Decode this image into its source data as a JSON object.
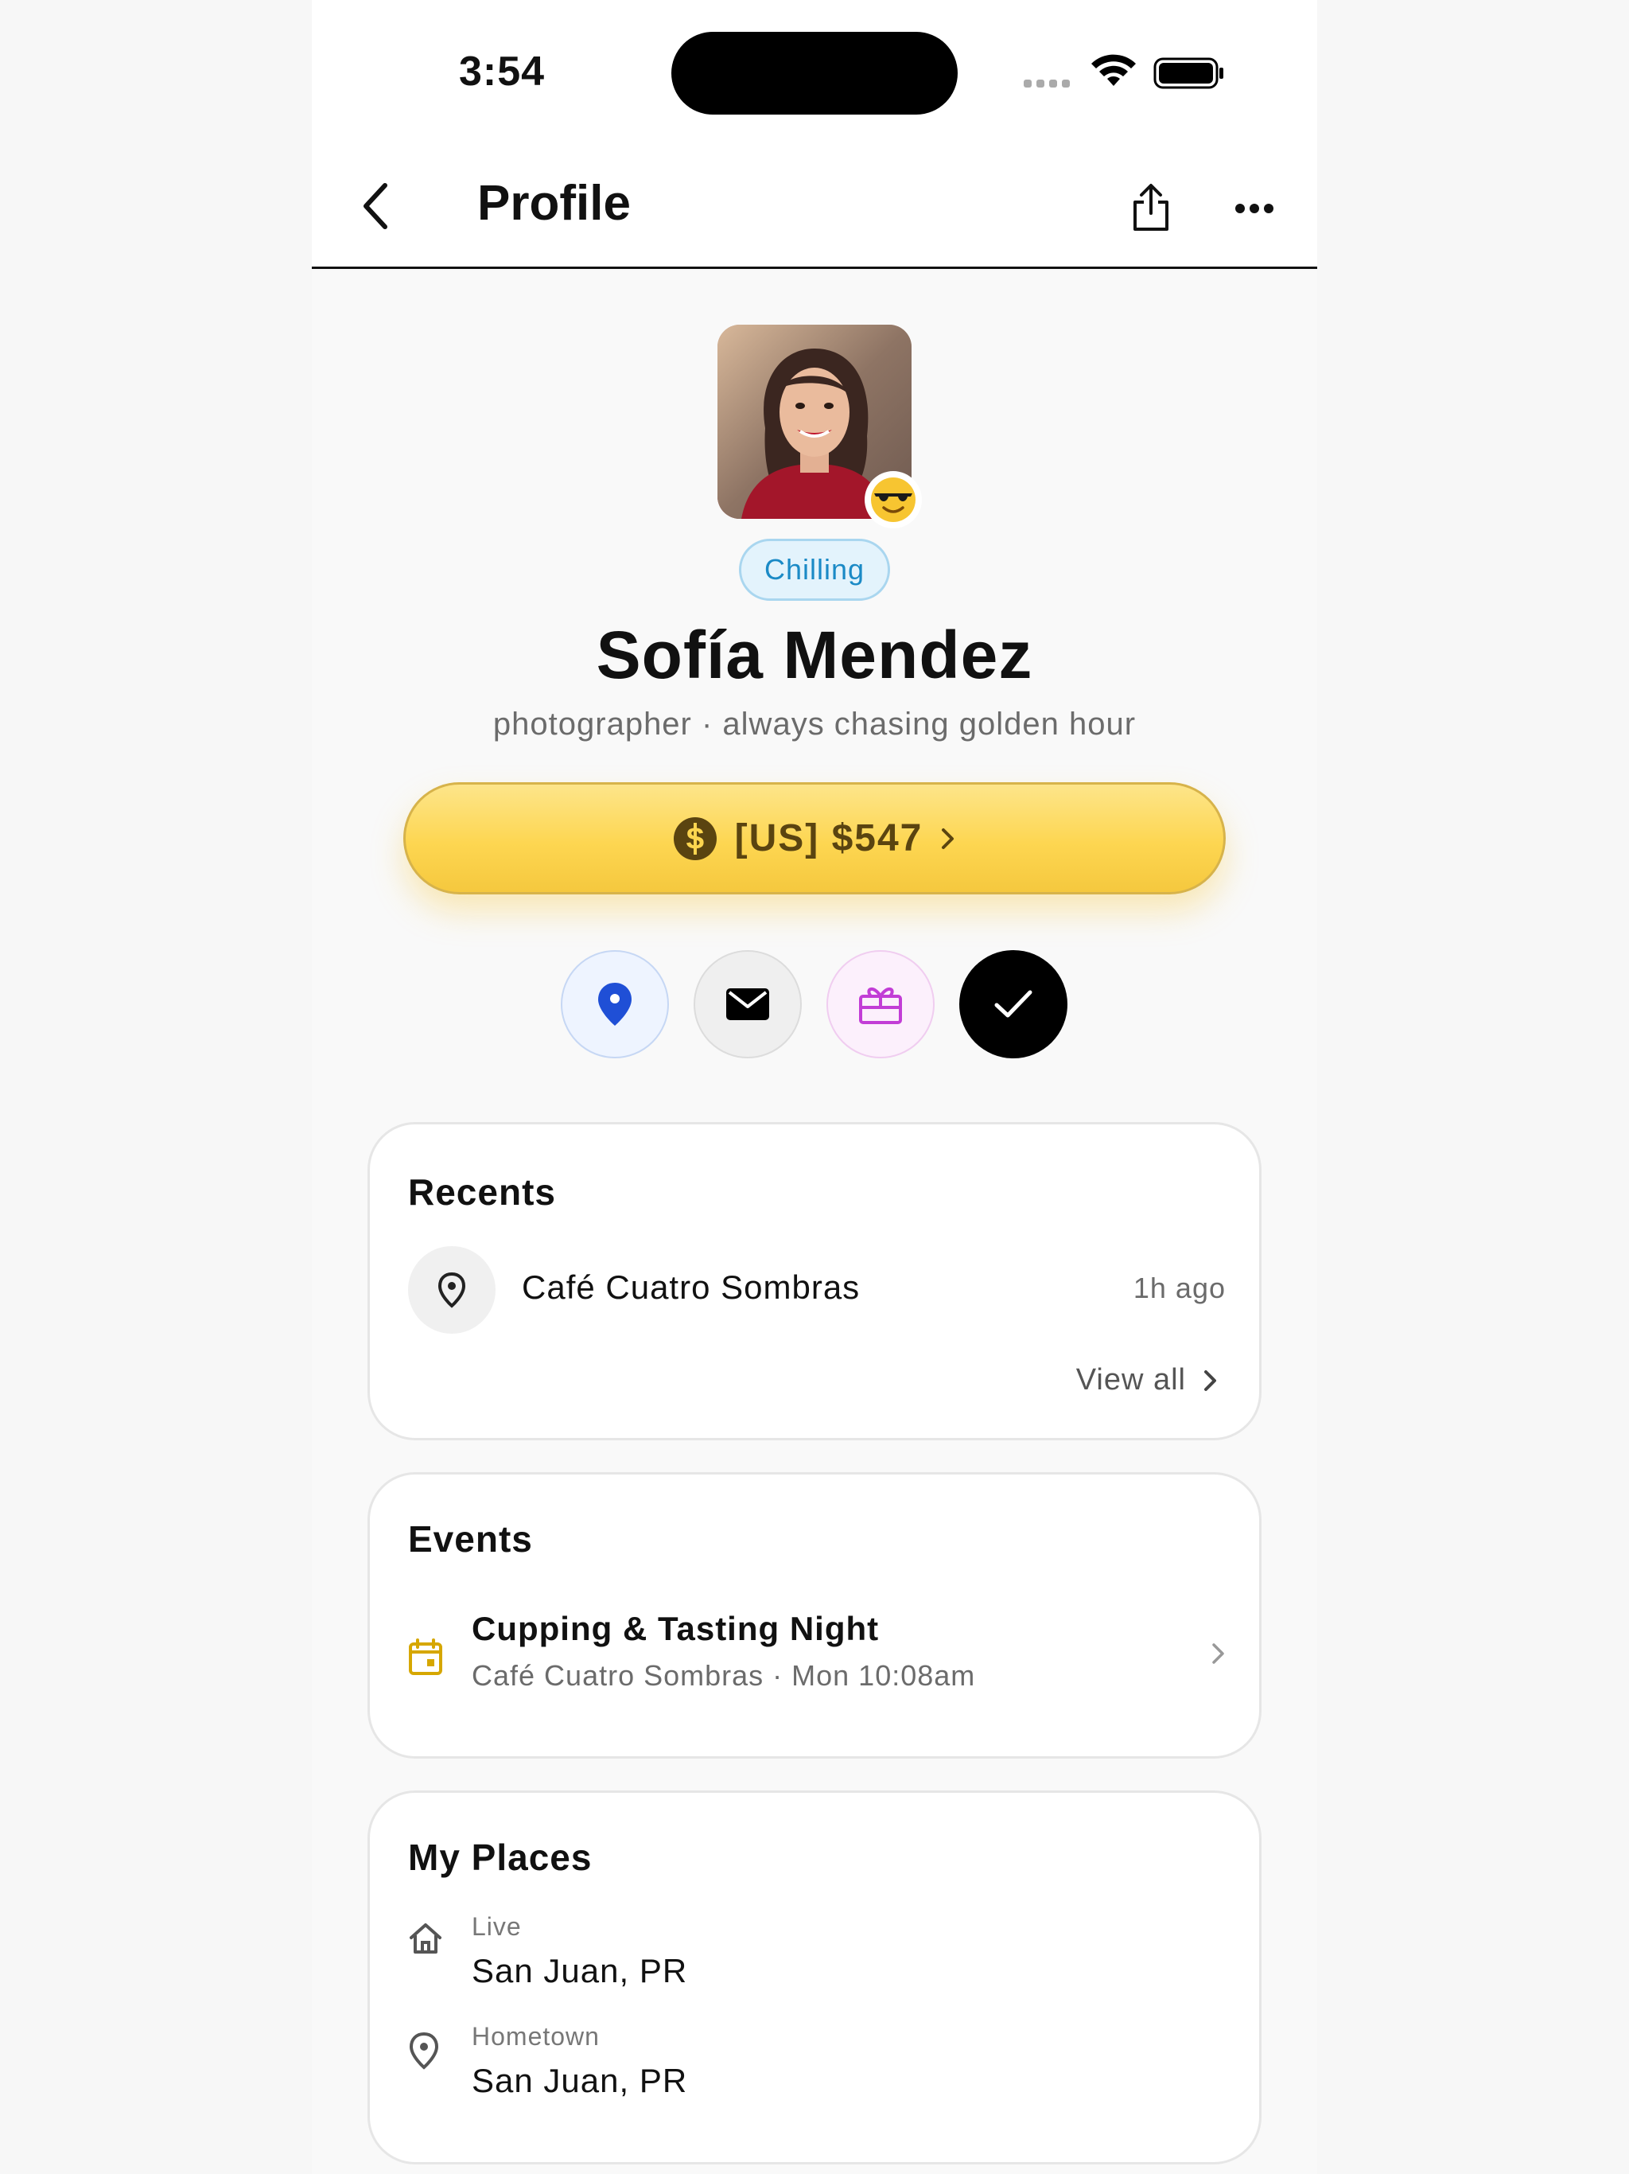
{
  "status_bar": {
    "time": "3:54"
  },
  "nav": {
    "title": "Profile"
  },
  "profile": {
    "status": "Chilling",
    "name": "Sofía Mendez",
    "bio": "photographer · always chasing golden hour",
    "emoji_badge": "😎"
  },
  "balance": {
    "label": "[US] $547"
  },
  "colors": {
    "balance_gradient_top": "#fde58a",
    "balance_gradient_bottom": "#f5c83e",
    "location_blue": "#1f4fd6",
    "gift_magenta": "#c23dd6",
    "status_blue": "#1b8ac6",
    "event_yellow": "#d6a700"
  },
  "actions": [
    {
      "icon": "location-pin-icon"
    },
    {
      "icon": "mail-icon"
    },
    {
      "icon": "gift-icon"
    },
    {
      "icon": "check-icon"
    }
  ],
  "recents": {
    "title": "Recents",
    "items": [
      {
        "name": "Café Cuatro Sombras",
        "time": "1h ago"
      }
    ],
    "view_all": "View all"
  },
  "events": {
    "title": "Events",
    "items": [
      {
        "title": "Cupping & Tasting Night",
        "subtitle": "Café Cuatro Sombras · Mon 10:08am"
      }
    ]
  },
  "places": {
    "title": "My Places",
    "items": [
      {
        "label": "Live",
        "value": "San Juan, PR"
      },
      {
        "label": "Hometown",
        "value": "San Juan, PR"
      }
    ]
  }
}
